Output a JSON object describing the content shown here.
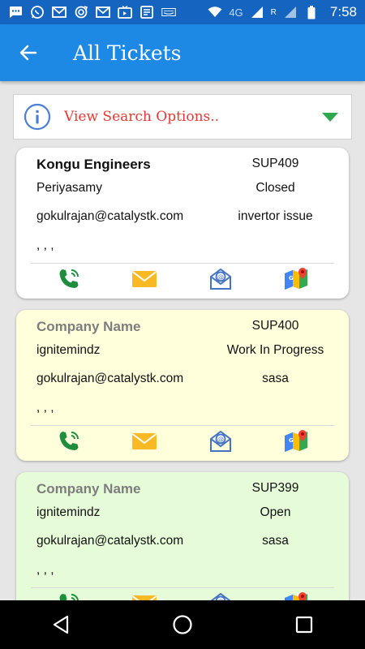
{
  "status_bar": {
    "icons": [
      "message-icon",
      "whatsapp-icon",
      "gmail-icon",
      "sync-icon",
      "gmail-icon",
      "tv-icon",
      "news-icon",
      "amazon-icon"
    ],
    "network": "4G",
    "roaming": "R",
    "time": "7:58"
  },
  "app_bar": {
    "title": "All Tickets"
  },
  "search": {
    "label": "View Search Options.."
  },
  "tickets": [
    {
      "company": "Kongu Engineers",
      "id": "SUP409",
      "contact": "Periyasamy",
      "status": "Closed",
      "email": "gokulrajan@catalystk.com",
      "issue": "invertor issue",
      "address": ", , ,",
      "bg": "#ffffff",
      "placeholder": false
    },
    {
      "company": "Company Name",
      "id": "SUP400",
      "contact": "ignitemindz",
      "status": "Work In Progress",
      "email": "gokulrajan@catalystk.com",
      "issue": "sasa",
      "address": ", , ,",
      "bg": "#ffffdc",
      "placeholder": true
    },
    {
      "company": "Company Name",
      "id": "SUP399",
      "contact": "ignitemindz",
      "status": "Open",
      "email": "gokulrajan@catalystk.com",
      "issue": "sasa",
      "address": ", , ,",
      "bg": "#e6fbd8",
      "placeholder": true
    }
  ],
  "colors": {
    "app_bar": "#1e88e5",
    "status_bar": "#1565c0",
    "search_label": "#e53935",
    "caret": "#2ea84f"
  }
}
